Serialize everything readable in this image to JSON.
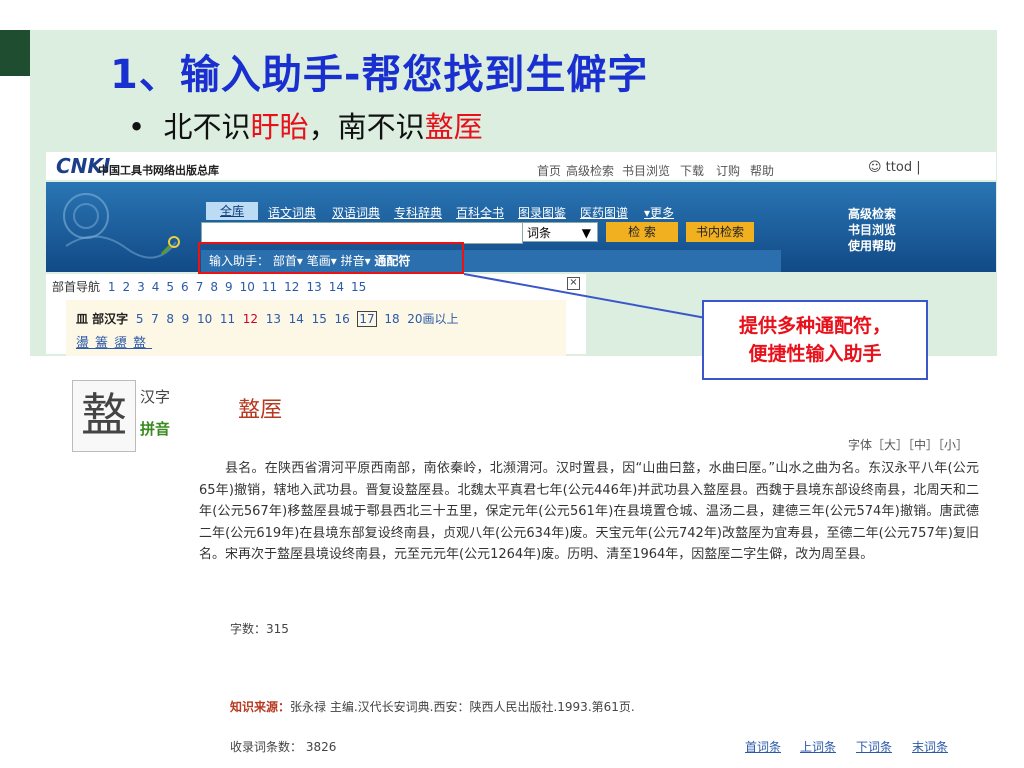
{
  "slide": {
    "title": "1、输入助手-帮您找到生僻字",
    "bullet_parts": [
      "北不识",
      "盱眙",
      "，南不识",
      "盩厔"
    ]
  },
  "cnki": {
    "logo": "CNKI",
    "logo_sub": "中国工具书网络出版总库",
    "top_nav": [
      "首页",
      "高级检索",
      "书目浏览",
      "下载",
      "订购",
      "帮助"
    ],
    "user": "☺ ttod |",
    "tabs": [
      "全库",
      "语文词典",
      "双语词典",
      "专科辞典",
      "百科全书",
      "图录图鉴",
      "医药图谱",
      "更多"
    ],
    "search_type": "词条",
    "search_button": "检 索",
    "in_book_button": "书内检索",
    "side_links": [
      "高级检索",
      "书目浏览",
      "使用帮助"
    ],
    "assist_label": "输入助手：",
    "assist_items": [
      "部首▾",
      "笔画▾",
      "拼音▾",
      "通配符"
    ],
    "radical_nav_label": "部首导航",
    "radical_numbers": [
      "1",
      "2",
      "3",
      "4",
      "5",
      "6",
      "7",
      "8",
      "9",
      "10",
      "11",
      "12",
      "13",
      "14",
      "15"
    ],
    "close_symbol": "×",
    "radical_name": "皿 部汉字",
    "stroke_numbers": [
      "5",
      "7",
      "8",
      "9",
      "10",
      "11",
      "12",
      "13",
      "14",
      "15",
      "16",
      "17",
      "18",
      "20画以上"
    ],
    "selected_stroke": "17",
    "highlighted_stroke": "12",
    "radical_chars": [
      "盪",
      "篕",
      "盨",
      "盩"
    ]
  },
  "callout": {
    "line1": "提供多种通配符，",
    "line2": "便捷性输入助手"
  },
  "entry": {
    "char": "盩",
    "hanzi_label": "汉字",
    "pinyin_label": "拼音",
    "title": "盩厔",
    "font_size_label": "字体［大］［中］［小］",
    "body": "县名。在陕西省渭河平原西南部，南依秦岭，北濒渭河。汉时置县，因“山曲曰盩，水曲曰厔。”山水之曲为名。东汉永平八年(公元65年)撤销，辖地入武功县。晋复设盩厔县。北魏太平真君七年(公元446年)并武功县入盩厔县。西魏于县境东部设终南县，北周天和二年(公元567年)移盩厔县城于鄠县西北三十五里，保定元年(公元561年)在县境置仓城、温汤二县，建德三年(公元574年)撤销。唐武德二年(公元619年)在县境东部复设终南县，贞观八年(公元634年)废。天宝元年(公元742年)改盩厔为宜寿县，至德二年(公元757年)复旧名。宋再次于盩厔县境设终南县，元至元元年(公元1264年)废。历明、清至1964年，因盩厔二字生僻，改为周至县。",
    "char_count": "字数：315",
    "source_label": "知识来源：",
    "source_text": "张永禄 主编.汉代长安词典.西安：陕西人民出版社.1993.第61页.",
    "total": "收录词条数： 3826",
    "pager": [
      "首词条",
      "上词条",
      "下词条",
      "末词条"
    ]
  }
}
